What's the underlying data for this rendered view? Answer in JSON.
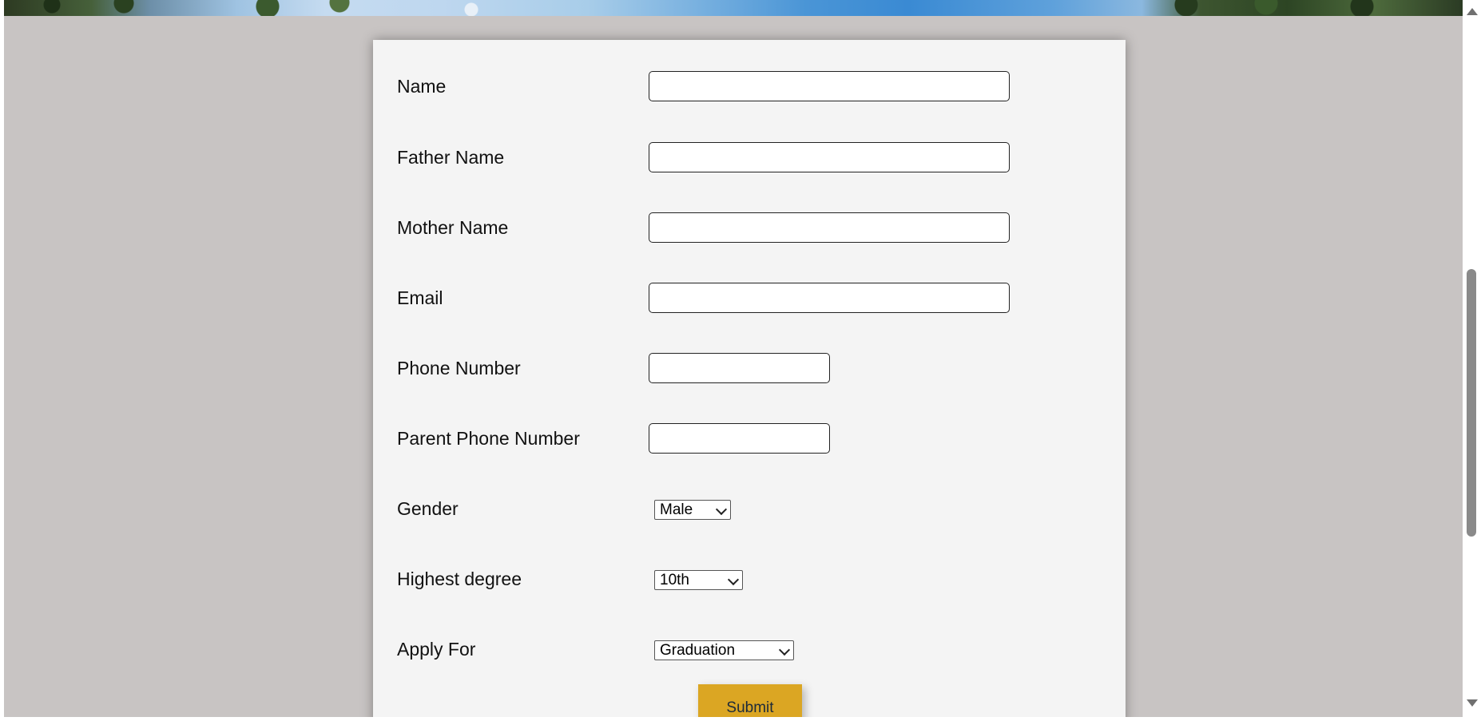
{
  "form": {
    "fields": {
      "name": {
        "label": "Name",
        "value": ""
      },
      "father_name": {
        "label": "Father Name",
        "value": ""
      },
      "mother_name": {
        "label": "Mother Name",
        "value": ""
      },
      "email": {
        "label": "Email",
        "value": ""
      },
      "phone": {
        "label": "Phone Number",
        "value": ""
      },
      "parent_phone": {
        "label": "Parent Phone Number",
        "value": ""
      },
      "gender": {
        "label": "Gender",
        "selected": "Male"
      },
      "degree": {
        "label": "Highest degree",
        "selected": "10th"
      },
      "apply_for": {
        "label": "Apply For",
        "selected": "Graduation"
      }
    },
    "submit_label": "Submit"
  },
  "colors": {
    "page_background": "#c8c4c3",
    "card_background": "#f4f4f4",
    "submit_button": "#dba623"
  }
}
